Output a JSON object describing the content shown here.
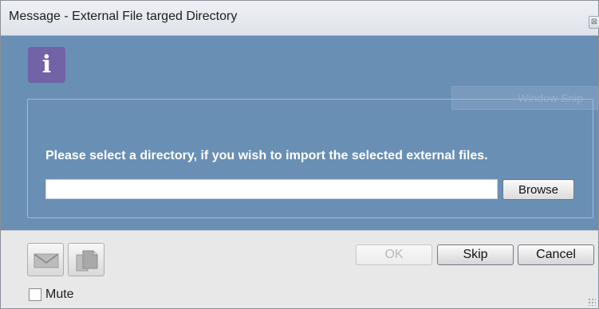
{
  "window": {
    "title": "Message - External File targed Directory",
    "close_icon": "close-icon"
  },
  "info": {
    "icon": "info-icon",
    "glyph": "i",
    "color": "#7163a5"
  },
  "overlay": {
    "text": "Window Snip"
  },
  "dialog": {
    "prompt": "Please select a directory, if you wish to import the selected external files.",
    "directory_value": "",
    "browse_label": "Browse",
    "background_color": "#6a8fb5"
  },
  "footer": {
    "email_icon": "envelope-icon",
    "copy_icon": "copy-icon",
    "ok_label": "OK",
    "skip_label": "Skip",
    "cancel_label": "Cancel",
    "mute_label": "Mute",
    "mute_checked": false
  }
}
